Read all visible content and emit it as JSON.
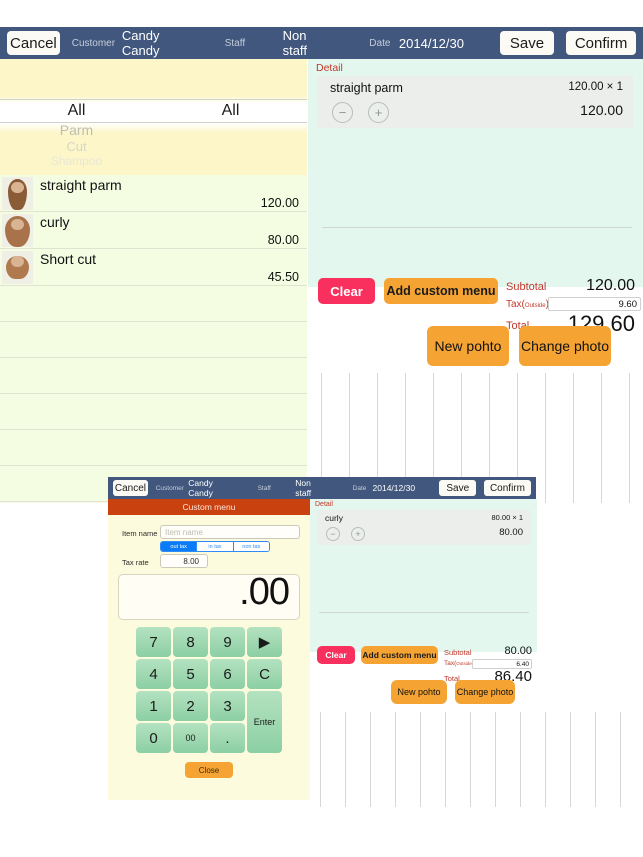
{
  "toolbar": {
    "cancel": "Cancel",
    "customer_label": "Customer",
    "customer_value": "Candy Candy",
    "staff_label": "Staff",
    "staff_value": "Non staff",
    "date_label": "Date",
    "date_value": "2014/12/30",
    "save": "Save",
    "confirm": "Confirm"
  },
  "left_panel": {
    "picker_category": {
      "selected": "All",
      "options": [
        "Parm",
        "Cut",
        "Shampoo"
      ]
    },
    "picker_subcategory": {
      "selected": "All"
    },
    "menu_items": [
      {
        "name": "straight parm",
        "price": "120.00",
        "thumb": "hair-long-straight-icon"
      },
      {
        "name": "curly",
        "price": "80.00",
        "thumb": "hair-curly-icon"
      },
      {
        "name": "Short cut",
        "price": "45.50",
        "thumb": "hair-short-icon"
      }
    ],
    "empty_rows": 6
  },
  "detail_main": {
    "title": "Detail",
    "item": {
      "name": "straight parm",
      "unit_line": "120.00 × 1",
      "amount": "120.00",
      "minus": "−",
      "plus": "+"
    },
    "clear_button": "Clear",
    "add_custom_button": "Add custom menu",
    "subtotal_label": "Subtotal",
    "subtotal_value": "120.00",
    "tax_label": "Tax(",
    "tax_label_sub": "Outside",
    "tax_label_end": ")",
    "tax_value": "9.60",
    "total_label": "Total",
    "total_value": "129.60"
  },
  "detail_background": {
    "title": "Detail",
    "item": {
      "name": "curly",
      "unit_line": "80.00 × 1",
      "amount": "80.00",
      "minus": "−",
      "plus": "+"
    },
    "clear_button": "Clear",
    "add_custom_button": "Add custom menu",
    "subtotal_label": "Subtotal",
    "subtotal_value": "80.00",
    "tax_label": "Tax(",
    "tax_label_sub": "Outside",
    "tax_label_end": ")",
    "tax_value": "6.40",
    "total_label": "Total",
    "total_value": "86.40"
  },
  "photo_main": {
    "new_photo": "New pohto",
    "change_photo": "Change photo"
  },
  "photo_background": {
    "new_photo": "New pohto",
    "change_photo": "Change photo"
  },
  "custom_menu_modal": {
    "title": "Custom menu",
    "item_name_label": "Item name",
    "item_name_value": "",
    "item_name_placeholder": "Item name",
    "tax_mode_options": [
      "out tax",
      "in tax",
      "non tax"
    ],
    "tax_mode_selected": "out tax",
    "tax_rate_label": "Tax rate",
    "tax_rate_value": "8.00",
    "display_value": ".00",
    "keys": [
      "7",
      "8",
      "9",
      "▶",
      "4",
      "5",
      "6",
      "C",
      "1",
      "2",
      "3",
      "0",
      "00",
      ".",
      "Enter"
    ],
    "close_button": "Close"
  },
  "colors": {
    "toolbar": "#41577d",
    "accent_orange": "#f5a434",
    "clear_pink": "#f9305e",
    "detail_bg": "#e3f7ef",
    "menu_bg": "#f4fce2",
    "modal_bg": "#fdfbdd",
    "modal_title": "#c8410f",
    "segment_blue": "#0a7cf7",
    "total_label": "#c0392b",
    "keypad_green": "#8ccfa4"
  }
}
